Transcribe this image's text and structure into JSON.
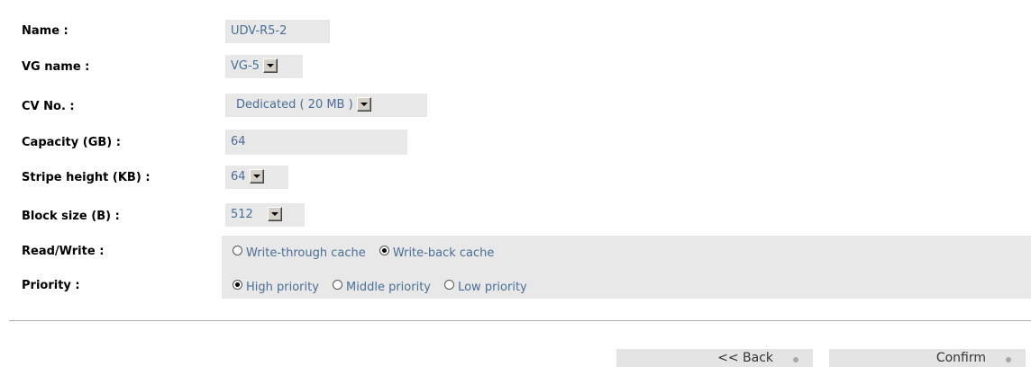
{
  "form": {
    "name": {
      "label": "Name :",
      "value": "UDV-R5-2"
    },
    "vg_name": {
      "label": "VG name :",
      "value": "VG-5"
    },
    "cv_no": {
      "label": "CV No. :",
      "value": "Dedicated ( 20 MB )"
    },
    "capacity": {
      "label": "Capacity (GB) :",
      "value": "64"
    },
    "stripe_height": {
      "label": "Stripe height (KB) :",
      "value": "64"
    },
    "block_size": {
      "label": "Block size (B) :",
      "value": "512"
    },
    "read_write": {
      "label": "Read/Write :",
      "options": [
        {
          "label": "Write-through cache",
          "selected": false
        },
        {
          "label": "Write-back cache",
          "selected": true
        }
      ]
    },
    "priority": {
      "label": "Priority :",
      "options": [
        {
          "label": "High priority",
          "selected": true
        },
        {
          "label": "Middle priority",
          "selected": false
        },
        {
          "label": "Low priority",
          "selected": false
        }
      ]
    }
  },
  "buttons": {
    "back": "<< Back",
    "confirm": "Confirm"
  },
  "colors": {
    "value_text": "#4a6e96",
    "field_bg": "#e8e8e8"
  }
}
